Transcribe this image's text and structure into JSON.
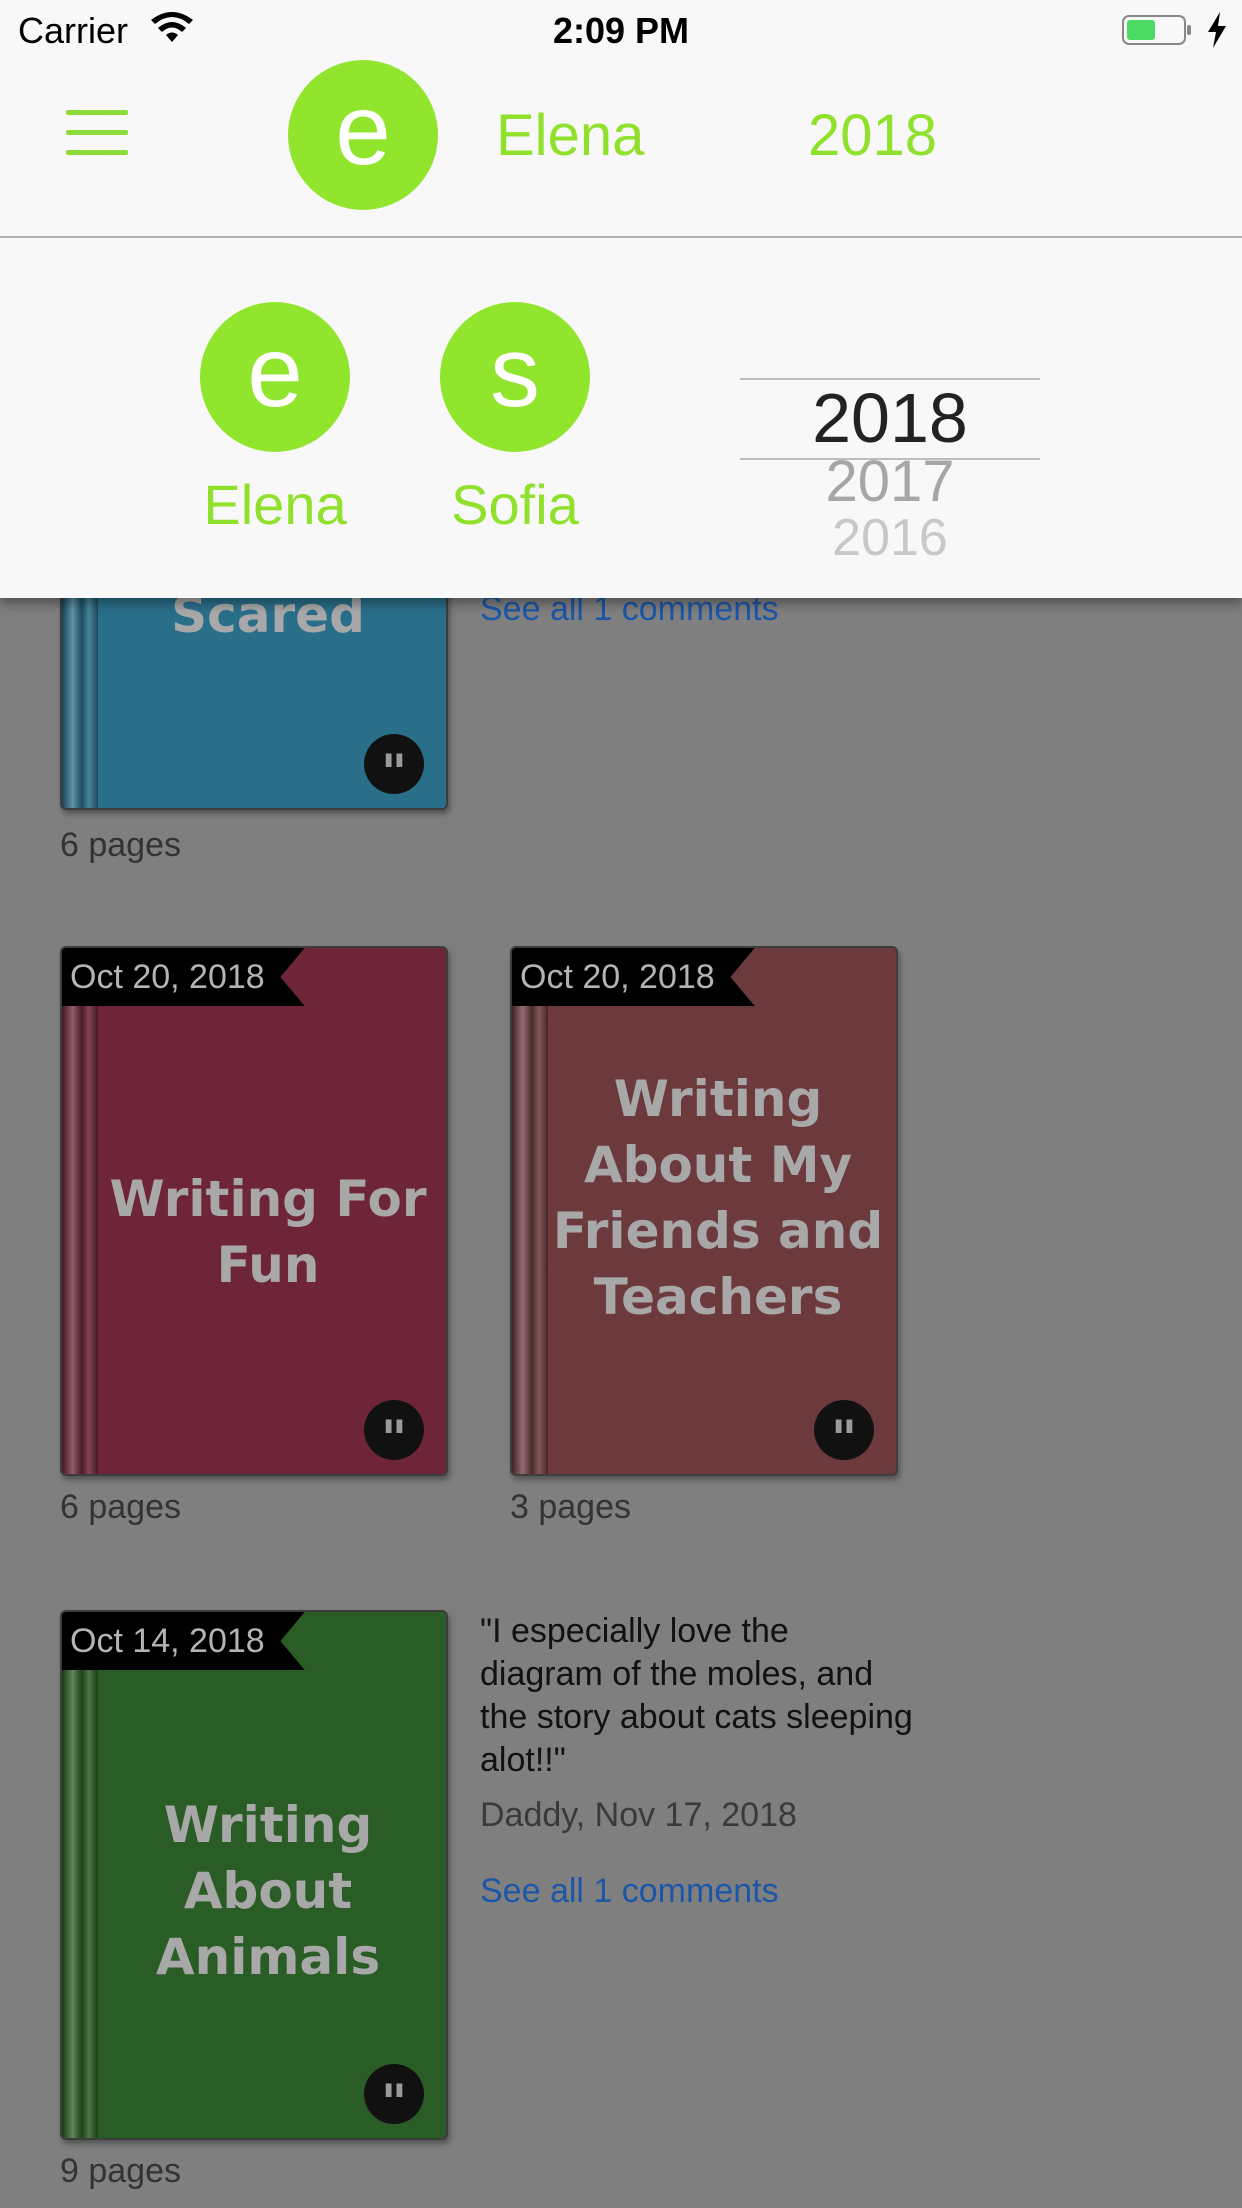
{
  "status": {
    "carrier": "Carrier",
    "time": "2:09 PM"
  },
  "header": {
    "avatar_letter": "e",
    "name": "Elena",
    "year": "2018"
  },
  "panel": {
    "kids": [
      {
        "letter": "e",
        "name": "Elena"
      },
      {
        "letter": "s",
        "name": "Sofia"
      }
    ],
    "years": {
      "selected": "2018",
      "next": "2017",
      "next2": "2016"
    }
  },
  "colors": {
    "accent": "#91e52c",
    "link": "#1b56a8"
  },
  "books": [
    {
      "title": "Scared",
      "date": "",
      "pages": "6 pages",
      "color": "#2a6f8a"
    },
    {
      "title": "Writing For Fun",
      "date": "Oct 20, 2018",
      "pages": "6 pages",
      "color": "#6e2538"
    },
    {
      "title": "Writing About My Friends and Teachers",
      "date": "Oct 20, 2018",
      "pages": "3 pages",
      "color": "#6c3a3d"
    },
    {
      "title": "Writing About Animals",
      "date": "Oct 14, 2018",
      "pages": "9 pages",
      "color": "#2a5d25"
    }
  ],
  "comments": {
    "first_see_all": "See all 1 comments",
    "animals": {
      "text": "\"I especially love the diagram of the moles, and the story about cats sleeping alot!!\"",
      "by": "Daddy, Nov 17, 2018",
      "see_all": "See all 1 comments"
    }
  },
  "icons": {
    "menu": "hamburger-icon",
    "quote": "quote-icon",
    "wifi": "wifi-icon",
    "battery": "battery-icon"
  }
}
